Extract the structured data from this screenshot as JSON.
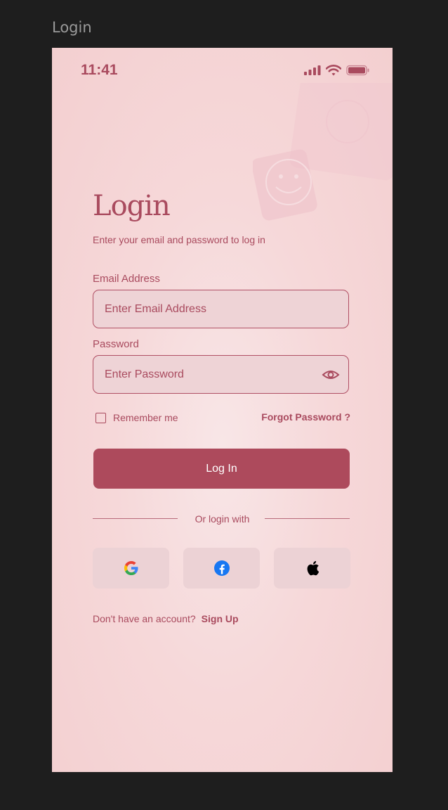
{
  "canvas": {
    "frame_label": "Login"
  },
  "status_bar": {
    "time": "11:41"
  },
  "login": {
    "title": "Login",
    "subtitle": "Enter your email and password to log in",
    "email_label": "Email Address",
    "email_placeholder": "Enter Email Address",
    "password_label": "Password",
    "password_placeholder": "Enter Password",
    "remember_label": "Remember me",
    "forgot_label": "Forgot Password ?",
    "login_button": "Log In",
    "divider_text": "Or login with",
    "signup_prompt": "Don't have an account?",
    "signup_link": "Sign Up"
  },
  "social_buttons": [
    {
      "icon": "google-icon"
    },
    {
      "icon": "facebook-icon"
    },
    {
      "icon": "apple-icon"
    }
  ],
  "colors": {
    "accent": "#ad4a5c",
    "text": "#a94a5e",
    "background": "#f6d8d9",
    "input_bg": "#eed3d6"
  }
}
